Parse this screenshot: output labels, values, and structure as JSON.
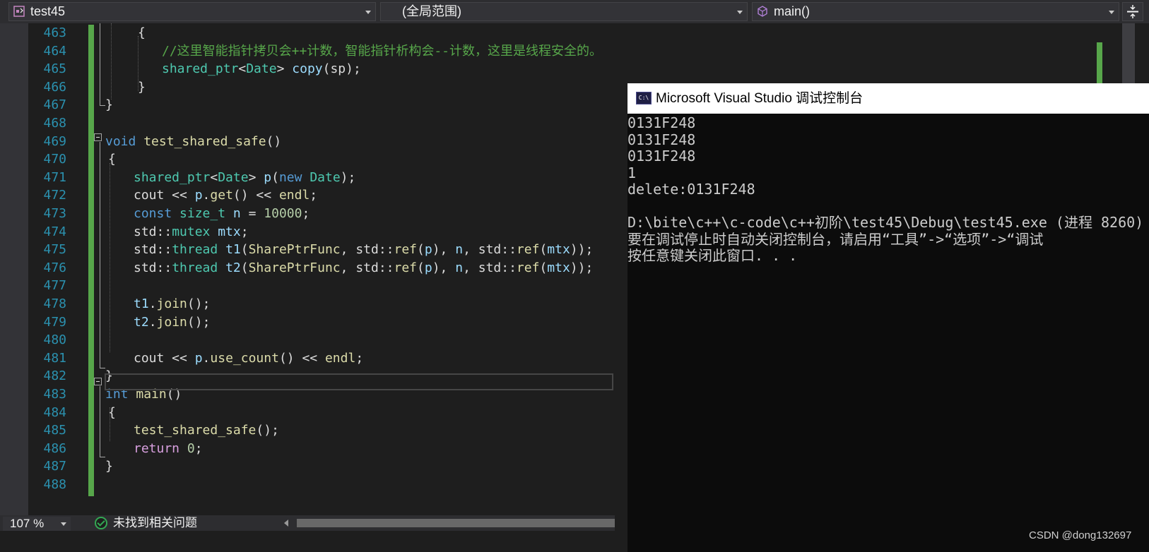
{
  "navbar": {
    "project": "test45",
    "scope": "(全局范围)",
    "member": "main()"
  },
  "editor": {
    "lines": [
      {
        "num": "463",
        "tokens": [
          {
            "c": "",
            "t": "{"
          }
        ]
      },
      {
        "num": "464",
        "tokens": [
          {
            "c": "cm",
            "t": "//这里智能指针拷贝会++计数，智能指针析构会--计数，这里是线程安全的。"
          }
        ]
      },
      {
        "num": "465",
        "tokens": [
          {
            "c": "ty",
            "t": "shared_ptr"
          },
          {
            "c": "",
            "t": "<"
          },
          {
            "c": "ty",
            "t": "Date"
          },
          {
            "c": "",
            "t": "> "
          },
          {
            "c": "var",
            "t": "copy"
          },
          {
            "c": "",
            "t": "(sp);"
          }
        ]
      },
      {
        "num": "466",
        "tokens": [
          {
            "c": "",
            "t": "}"
          }
        ]
      },
      {
        "num": "467",
        "tokens": [
          {
            "c": "",
            "t": "}"
          }
        ]
      },
      {
        "num": "468",
        "tokens": []
      },
      {
        "num": "469",
        "tokens": [
          {
            "c": "kw",
            "t": "void"
          },
          {
            "c": "",
            "t": " "
          },
          {
            "c": "fn",
            "t": "test_shared_safe"
          },
          {
            "c": "",
            "t": "()"
          }
        ]
      },
      {
        "num": "470",
        "tokens": [
          {
            "c": "",
            "t": "{"
          }
        ]
      },
      {
        "num": "471",
        "tokens": [
          {
            "c": "ty",
            "t": "shared_ptr"
          },
          {
            "c": "",
            "t": "<"
          },
          {
            "c": "ty",
            "t": "Date"
          },
          {
            "c": "",
            "t": "> "
          },
          {
            "c": "var",
            "t": "p"
          },
          {
            "c": "",
            "t": "("
          },
          {
            "c": "kw",
            "t": "new"
          },
          {
            "c": "",
            "t": " "
          },
          {
            "c": "ty",
            "t": "Date"
          },
          {
            "c": "",
            "t": ");"
          }
        ]
      },
      {
        "num": "472",
        "tokens": [
          {
            "c": "",
            "t": "cout << "
          },
          {
            "c": "var",
            "t": "p"
          },
          {
            "c": "",
            "t": "."
          },
          {
            "c": "fn",
            "t": "get"
          },
          {
            "c": "",
            "t": "() << "
          },
          {
            "c": "fn",
            "t": "endl"
          },
          {
            "c": "",
            "t": ";"
          }
        ]
      },
      {
        "num": "473",
        "tokens": [
          {
            "c": "kw",
            "t": "const"
          },
          {
            "c": "",
            "t": " "
          },
          {
            "c": "ty",
            "t": "size_t"
          },
          {
            "c": "",
            "t": " "
          },
          {
            "c": "var",
            "t": "n"
          },
          {
            "c": "",
            "t": " = "
          },
          {
            "c": "num",
            "t": "10000"
          },
          {
            "c": "",
            "t": ";"
          }
        ]
      },
      {
        "num": "474",
        "tokens": [
          {
            "c": "",
            "t": "std::"
          },
          {
            "c": "ty",
            "t": "mutex"
          },
          {
            "c": "",
            "t": " "
          },
          {
            "c": "var",
            "t": "mtx"
          },
          {
            "c": "",
            "t": ";"
          }
        ]
      },
      {
        "num": "475",
        "tokens": [
          {
            "c": "",
            "t": "std::"
          },
          {
            "c": "ty",
            "t": "thread"
          },
          {
            "c": "",
            "t": " "
          },
          {
            "c": "var",
            "t": "t1"
          },
          {
            "c": "",
            "t": "("
          },
          {
            "c": "fn",
            "t": "SharePtrFunc"
          },
          {
            "c": "",
            "t": ", std::"
          },
          {
            "c": "fn",
            "t": "ref"
          },
          {
            "c": "",
            "t": "("
          },
          {
            "c": "var",
            "t": "p"
          },
          {
            "c": "",
            "t": "), "
          },
          {
            "c": "var",
            "t": "n"
          },
          {
            "c": "",
            "t": ", std::"
          },
          {
            "c": "fn",
            "t": "ref"
          },
          {
            "c": "",
            "t": "("
          },
          {
            "c": "var",
            "t": "mtx"
          },
          {
            "c": "",
            "t": "));"
          }
        ]
      },
      {
        "num": "476",
        "tokens": [
          {
            "c": "",
            "t": "std::"
          },
          {
            "c": "ty",
            "t": "thread"
          },
          {
            "c": "",
            "t": " "
          },
          {
            "c": "var",
            "t": "t2"
          },
          {
            "c": "",
            "t": "("
          },
          {
            "c": "fn",
            "t": "SharePtrFunc"
          },
          {
            "c": "",
            "t": ", std::"
          },
          {
            "c": "fn",
            "t": "ref"
          },
          {
            "c": "",
            "t": "("
          },
          {
            "c": "var",
            "t": "p"
          },
          {
            "c": "",
            "t": "), "
          },
          {
            "c": "var",
            "t": "n"
          },
          {
            "c": "",
            "t": ", std::"
          },
          {
            "c": "fn",
            "t": "ref"
          },
          {
            "c": "",
            "t": "("
          },
          {
            "c": "var",
            "t": "mtx"
          },
          {
            "c": "",
            "t": "));"
          }
        ]
      },
      {
        "num": "477",
        "tokens": []
      },
      {
        "num": "478",
        "tokens": [
          {
            "c": "var",
            "t": "t1"
          },
          {
            "c": "",
            "t": "."
          },
          {
            "c": "fn",
            "t": "join"
          },
          {
            "c": "",
            "t": "();"
          }
        ]
      },
      {
        "num": "479",
        "tokens": [
          {
            "c": "var",
            "t": "t2"
          },
          {
            "c": "",
            "t": "."
          },
          {
            "c": "fn",
            "t": "join"
          },
          {
            "c": "",
            "t": "();"
          }
        ]
      },
      {
        "num": "480",
        "tokens": []
      },
      {
        "num": "481",
        "tokens": [
          {
            "c": "",
            "t": "cout << "
          },
          {
            "c": "var",
            "t": "p"
          },
          {
            "c": "",
            "t": "."
          },
          {
            "c": "fn",
            "t": "use_count"
          },
          {
            "c": "",
            "t": "() << "
          },
          {
            "c": "fn",
            "t": "endl"
          },
          {
            "c": "",
            "t": ";"
          }
        ]
      },
      {
        "num": "482",
        "tokens": [
          {
            "c": "",
            "t": "}"
          }
        ]
      },
      {
        "num": "483",
        "tokens": [
          {
            "c": "kw",
            "t": "int"
          },
          {
            "c": "",
            "t": " "
          },
          {
            "c": "fn",
            "t": "main"
          },
          {
            "c": "",
            "t": "()"
          }
        ]
      },
      {
        "num": "484",
        "tokens": [
          {
            "c": "",
            "t": "{"
          }
        ]
      },
      {
        "num": "485",
        "tokens": [
          {
            "c": "fn",
            "t": "test_shared_safe"
          },
          {
            "c": "",
            "t": "();"
          }
        ]
      },
      {
        "num": "486",
        "tokens": [
          {
            "c": "ctl",
            "t": "return"
          },
          {
            "c": "",
            "t": " "
          },
          {
            "c": "num",
            "t": "0"
          },
          {
            "c": "",
            "t": ";"
          }
        ]
      },
      {
        "num": "487",
        "tokens": [
          {
            "c": "",
            "t": "}"
          }
        ]
      },
      {
        "num": "488",
        "tokens": []
      }
    ]
  },
  "status": {
    "zoom": "107 %",
    "issues": "未找到相关问题"
  },
  "console": {
    "title": "Microsoft Visual Studio 调试控制台",
    "icon_text": "C:\\",
    "lines": [
      "0131F248",
      "0131F248",
      "0131F248",
      "1",
      "delete:0131F248",
      "",
      "D:\\bite\\c++\\c-code\\c++初阶\\test45\\Debug\\test45.exe (进程 8260)",
      "要在调试停止时自动关闭控制台，请启用“工具”->“选项”->“调试",
      "按任意键关闭此窗口. . ."
    ]
  },
  "watermark": "CSDN @dong132697"
}
